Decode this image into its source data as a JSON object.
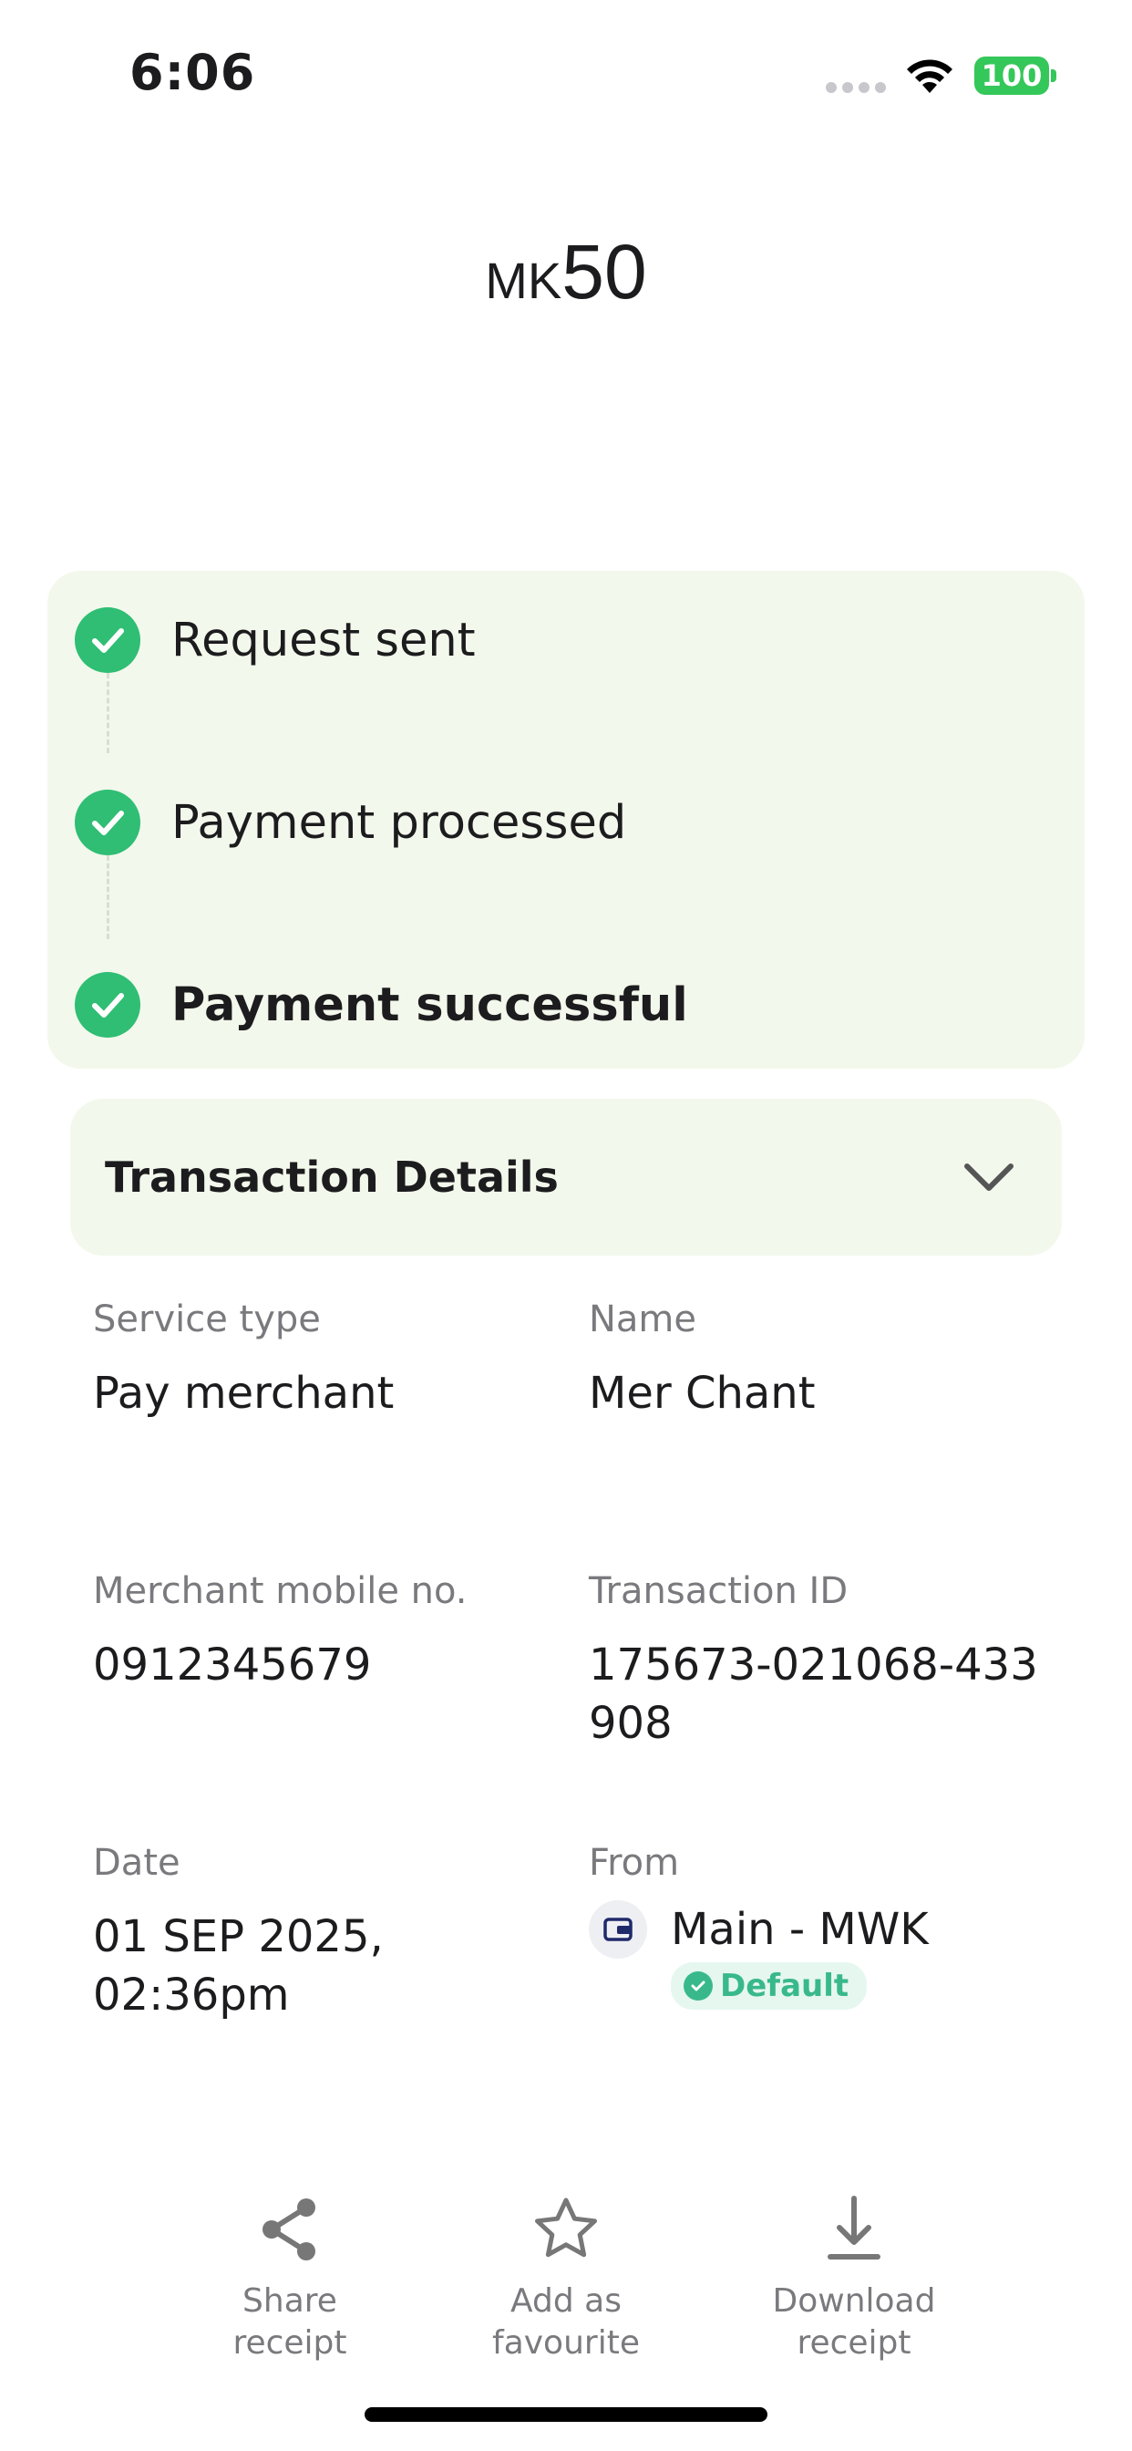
{
  "status_bar": {
    "time": "6:06",
    "battery": "100"
  },
  "amount": {
    "currency": "MK",
    "value": "50"
  },
  "progress": {
    "steps": [
      {
        "label": "Request sent"
      },
      {
        "label": "Payment processed"
      },
      {
        "label": "Payment successful"
      }
    ]
  },
  "details": {
    "title": "Transaction Details",
    "fields": {
      "service_type": {
        "label": "Service type",
        "value": "Pay merchant"
      },
      "name": {
        "label": "Name",
        "value": "Mer Chant"
      },
      "merchant_mobile": {
        "label": "Merchant mobile no.",
        "value": "0912345679"
      },
      "transaction_id": {
        "label": "Transaction ID",
        "value": "175673-021068-433908"
      },
      "date": {
        "label": "Date",
        "value": "01 SEP 2025, 02:36pm"
      },
      "from": {
        "label": "From",
        "value": "Main - MWK",
        "badge": "Default"
      }
    }
  },
  "actions": {
    "share": "Share\nreceipt",
    "favourite": "Add as\nfavourite",
    "download": "Download\nreceipt"
  },
  "colors": {
    "success_green": "#2fbe74",
    "card_bg": "#f3f8ec",
    "badge_teal": "#39b98b",
    "muted_text": "#7a7a7e"
  },
  "icons": [
    "wifi-icon",
    "battery-icon",
    "check-icon",
    "chevron-down-icon",
    "wallet-icon",
    "share-icon",
    "star-icon",
    "download-icon"
  ]
}
